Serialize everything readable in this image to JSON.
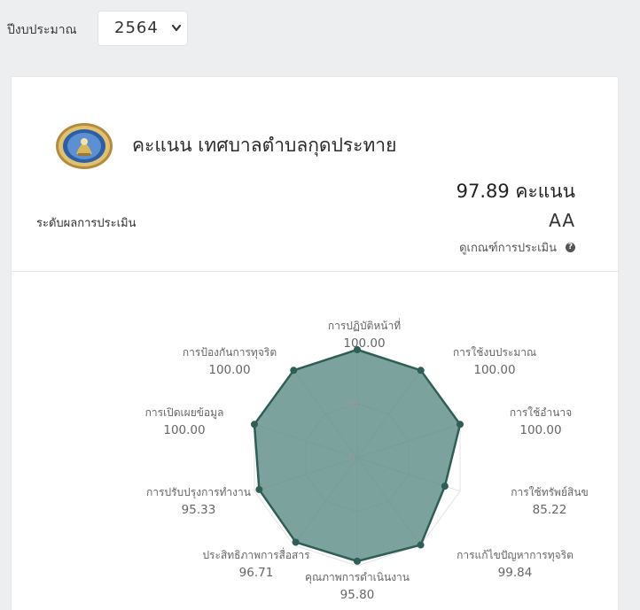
{
  "filter": {
    "year_label": "ปีงบประมาณ",
    "year_value": "2564"
  },
  "header": {
    "title": "คะแนน เทศบาลตำบลกุดประทาย",
    "score_text": "97.89 คะแนน",
    "level_label": "ระดับผลการประเมิน",
    "level_value": "AA",
    "criteria_link": "ดูเกณฑ์การประเมิน",
    "emblem_icon": "municipal-seal-icon"
  },
  "colors": {
    "fill": "#5f8d87",
    "stroke": "#2f5e56",
    "grid": "#e3e3e3"
  },
  "chart_data": {
    "type": "radar",
    "axis_max": 100,
    "ticks": [
      0,
      50,
      100
    ],
    "tick_labels": [
      "0",
      "50"
    ],
    "categories": [
      "การปฏิบัติหน้าที่",
      "การใช้งบประมาณ",
      "การใช้อำนาจ",
      "การใช้ทรัพย์สินข",
      "การแก้ไขปัญหาการทุจริต",
      "คุณภาพการดำเนินงาน",
      "ประสิทธิภาพการสื่อสาร",
      "การปรับปรุงการทำงาน",
      "การเปิดเผยข้อมูล",
      "การป้องกันการทุจริต"
    ],
    "values": [
      100.0,
      100.0,
      100.0,
      85.22,
      99.84,
      95.8,
      96.71,
      95.33,
      100.0,
      100.0
    ],
    "value_labels": [
      "100.00",
      "100.00",
      "100.00",
      "85.22",
      "99.84",
      "95.80",
      "96.71",
      "95.33",
      "100.00",
      "100.00"
    ]
  }
}
